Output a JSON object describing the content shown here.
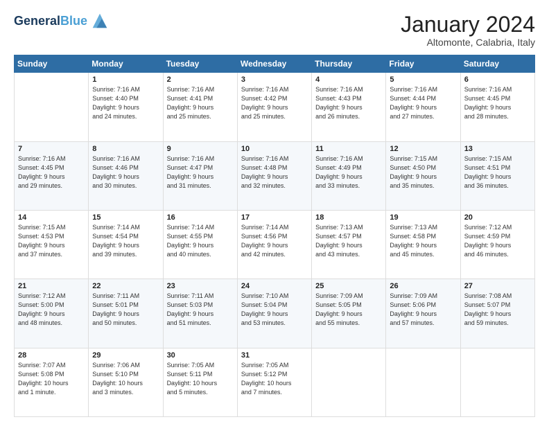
{
  "header": {
    "logo_line1": "General",
    "logo_line2": "Blue",
    "main_title": "January 2024",
    "subtitle": "Altomonte, Calabria, Italy"
  },
  "days_of_week": [
    "Sunday",
    "Monday",
    "Tuesday",
    "Wednesday",
    "Thursday",
    "Friday",
    "Saturday"
  ],
  "weeks": [
    [
      {
        "day": "",
        "content": ""
      },
      {
        "day": "1",
        "content": "Sunrise: 7:16 AM\nSunset: 4:40 PM\nDaylight: 9 hours\nand 24 minutes."
      },
      {
        "day": "2",
        "content": "Sunrise: 7:16 AM\nSunset: 4:41 PM\nDaylight: 9 hours\nand 25 minutes."
      },
      {
        "day": "3",
        "content": "Sunrise: 7:16 AM\nSunset: 4:42 PM\nDaylight: 9 hours\nand 25 minutes."
      },
      {
        "day": "4",
        "content": "Sunrise: 7:16 AM\nSunset: 4:43 PM\nDaylight: 9 hours\nand 26 minutes."
      },
      {
        "day": "5",
        "content": "Sunrise: 7:16 AM\nSunset: 4:44 PM\nDaylight: 9 hours\nand 27 minutes."
      },
      {
        "day": "6",
        "content": "Sunrise: 7:16 AM\nSunset: 4:45 PM\nDaylight: 9 hours\nand 28 minutes."
      }
    ],
    [
      {
        "day": "7",
        "content": "Sunrise: 7:16 AM\nSunset: 4:45 PM\nDaylight: 9 hours\nand 29 minutes."
      },
      {
        "day": "8",
        "content": "Sunrise: 7:16 AM\nSunset: 4:46 PM\nDaylight: 9 hours\nand 30 minutes."
      },
      {
        "day": "9",
        "content": "Sunrise: 7:16 AM\nSunset: 4:47 PM\nDaylight: 9 hours\nand 31 minutes."
      },
      {
        "day": "10",
        "content": "Sunrise: 7:16 AM\nSunset: 4:48 PM\nDaylight: 9 hours\nand 32 minutes."
      },
      {
        "day": "11",
        "content": "Sunrise: 7:16 AM\nSunset: 4:49 PM\nDaylight: 9 hours\nand 33 minutes."
      },
      {
        "day": "12",
        "content": "Sunrise: 7:15 AM\nSunset: 4:50 PM\nDaylight: 9 hours\nand 35 minutes."
      },
      {
        "day": "13",
        "content": "Sunrise: 7:15 AM\nSunset: 4:51 PM\nDaylight: 9 hours\nand 36 minutes."
      }
    ],
    [
      {
        "day": "14",
        "content": "Sunrise: 7:15 AM\nSunset: 4:53 PM\nDaylight: 9 hours\nand 37 minutes."
      },
      {
        "day": "15",
        "content": "Sunrise: 7:14 AM\nSunset: 4:54 PM\nDaylight: 9 hours\nand 39 minutes."
      },
      {
        "day": "16",
        "content": "Sunrise: 7:14 AM\nSunset: 4:55 PM\nDaylight: 9 hours\nand 40 minutes."
      },
      {
        "day": "17",
        "content": "Sunrise: 7:14 AM\nSunset: 4:56 PM\nDaylight: 9 hours\nand 42 minutes."
      },
      {
        "day": "18",
        "content": "Sunrise: 7:13 AM\nSunset: 4:57 PM\nDaylight: 9 hours\nand 43 minutes."
      },
      {
        "day": "19",
        "content": "Sunrise: 7:13 AM\nSunset: 4:58 PM\nDaylight: 9 hours\nand 45 minutes."
      },
      {
        "day": "20",
        "content": "Sunrise: 7:12 AM\nSunset: 4:59 PM\nDaylight: 9 hours\nand 46 minutes."
      }
    ],
    [
      {
        "day": "21",
        "content": "Sunrise: 7:12 AM\nSunset: 5:00 PM\nDaylight: 9 hours\nand 48 minutes."
      },
      {
        "day": "22",
        "content": "Sunrise: 7:11 AM\nSunset: 5:01 PM\nDaylight: 9 hours\nand 50 minutes."
      },
      {
        "day": "23",
        "content": "Sunrise: 7:11 AM\nSunset: 5:03 PM\nDaylight: 9 hours\nand 51 minutes."
      },
      {
        "day": "24",
        "content": "Sunrise: 7:10 AM\nSunset: 5:04 PM\nDaylight: 9 hours\nand 53 minutes."
      },
      {
        "day": "25",
        "content": "Sunrise: 7:09 AM\nSunset: 5:05 PM\nDaylight: 9 hours\nand 55 minutes."
      },
      {
        "day": "26",
        "content": "Sunrise: 7:09 AM\nSunset: 5:06 PM\nDaylight: 9 hours\nand 57 minutes."
      },
      {
        "day": "27",
        "content": "Sunrise: 7:08 AM\nSunset: 5:07 PM\nDaylight: 9 hours\nand 59 minutes."
      }
    ],
    [
      {
        "day": "28",
        "content": "Sunrise: 7:07 AM\nSunset: 5:08 PM\nDaylight: 10 hours\nand 1 minute."
      },
      {
        "day": "29",
        "content": "Sunrise: 7:06 AM\nSunset: 5:10 PM\nDaylight: 10 hours\nand 3 minutes."
      },
      {
        "day": "30",
        "content": "Sunrise: 7:05 AM\nSunset: 5:11 PM\nDaylight: 10 hours\nand 5 minutes."
      },
      {
        "day": "31",
        "content": "Sunrise: 7:05 AM\nSunset: 5:12 PM\nDaylight: 10 hours\nand 7 minutes."
      },
      {
        "day": "",
        "content": ""
      },
      {
        "day": "",
        "content": ""
      },
      {
        "day": "",
        "content": ""
      }
    ]
  ]
}
